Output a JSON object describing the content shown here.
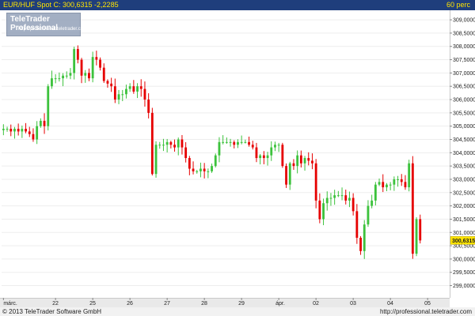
{
  "header": {
    "title": "EUR/HUF Spot C: 300,6315 -2,2285",
    "period": "60 perc"
  },
  "logo": {
    "name": "TeleTrader Professional",
    "url": "http://professional.teletrader.com"
  },
  "footer": {
    "copyright": "© 2013 TeleTrader Software GmbH",
    "url": "http://professional.teletrader.com"
  },
  "colors": {
    "up": "#3cc23c",
    "down": "#e60000",
    "header_bg": "#1f3e7c",
    "header_text": "#ffe400",
    "price_box": "#ffe400"
  },
  "chart_data": {
    "type": "candlestick",
    "title": "EUR/HUF Spot C: 300,6315 -2,2285",
    "interval": "60 perc",
    "last_price": "300,6315",
    "ylim": [
      298.6,
      309.3
    ],
    "y_ticks": [
      "299,0000",
      "299,5000",
      "300,0000",
      "300,5000",
      "301,0000",
      "301,5000",
      "302,0000",
      "302,5000",
      "303,0000",
      "303,5000",
      "304,0000",
      "304,5000",
      "305,0000",
      "305,5000",
      "306,0000",
      "306,5000",
      "307,0000",
      "307,5000",
      "308,0000",
      "308,5000",
      "309,0000"
    ],
    "y_tick_values": [
      299.0,
      299.5,
      300.0,
      300.5,
      301.0,
      301.5,
      302.0,
      302.5,
      303.0,
      303.5,
      304.0,
      304.5,
      305.0,
      305.5,
      306.0,
      306.5,
      307.0,
      307.5,
      308.0,
      308.5,
      309.0
    ],
    "x_ticks": [
      {
        "label": "márc.",
        "index": 0
      },
      {
        "label": "22",
        "index": 14
      },
      {
        "label": "25",
        "index": 24
      },
      {
        "label": "26",
        "index": 34
      },
      {
        "label": "27",
        "index": 44
      },
      {
        "label": "28",
        "index": 54
      },
      {
        "label": "29",
        "index": 64
      },
      {
        "label": "ápr.",
        "index": 74
      },
      {
        "label": "02",
        "index": 84
      },
      {
        "label": "03",
        "index": 94
      },
      {
        "label": "04",
        "index": 104
      },
      {
        "label": "05",
        "index": 114
      }
    ],
    "x_count": 120,
    "closes": [
      304.9,
      304.9,
      304.8,
      304.9,
      304.8,
      304.9,
      304.8,
      304.7,
      304.5,
      305.0,
      305.2,
      305.0,
      306.5,
      306.8,
      306.8,
      306.8,
      306.9,
      306.9,
      307.0,
      307.9,
      307.5,
      306.9,
      307.0,
      306.8,
      307.6,
      307.5,
      307.2,
      306.7,
      306.6,
      306.5,
      306.0,
      306.2,
      306.2,
      306.4,
      306.5,
      306.3,
      306.5,
      306.4,
      306.0,
      305.5,
      303.2,
      304.3,
      304.3,
      304.3,
      304.4,
      304.3,
      304.2,
      304.5,
      304.2,
      303.8,
      303.4,
      303.3,
      303.3,
      303.4,
      303.3,
      303.3,
      303.5,
      303.9,
      304.4,
      304.4,
      304.4,
      304.4,
      304.3,
      304.4,
      304.4,
      304.4,
      304.3,
      304.2,
      303.8,
      303.9,
      303.8,
      303.9,
      304.2,
      304.3,
      304.3,
      303.5,
      302.8,
      303.6,
      303.5,
      303.9,
      303.6,
      303.8,
      303.7,
      303.6,
      302.2,
      301.5,
      302.1,
      302.3,
      302.3,
      302.4,
      302.4,
      302.4,
      302.2,
      302.3,
      301.8,
      300.8,
      300.3,
      301.3,
      302.0,
      302.2,
      302.8,
      302.9,
      302.7,
      302.8,
      302.8,
      303.0,
      303.0,
      302.9,
      302.7,
      303.6,
      300.2,
      301.5,
      300.7
    ]
  }
}
